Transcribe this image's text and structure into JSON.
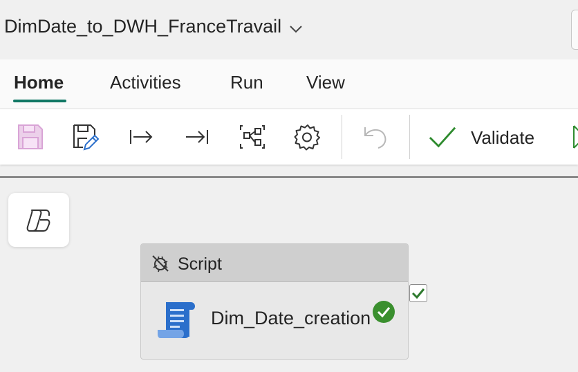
{
  "window": {
    "title": "DimDate_to_DWH_FranceTravail"
  },
  "tabs": [
    {
      "label": "Home",
      "active": true
    },
    {
      "label": "Activities",
      "active": false
    },
    {
      "label": "Run",
      "active": false
    },
    {
      "label": "View",
      "active": false
    }
  ],
  "toolbar": {
    "validate_label": "Validate",
    "icons": [
      "save-icon",
      "save-as-edit-icon",
      "run-start-icon",
      "run-end-icon",
      "node-map-icon",
      "settings-icon",
      "undo-icon",
      "validate-check-icon",
      "run-icon"
    ]
  },
  "activity": {
    "type_label": "Script",
    "name": "Dim_Date_creation",
    "status": "succeeded"
  },
  "colors": {
    "accent": "#117865",
    "check_green": "#2e8b2e",
    "script_blue": "#2b6fcb",
    "save_pink": "#d9a4d6"
  }
}
